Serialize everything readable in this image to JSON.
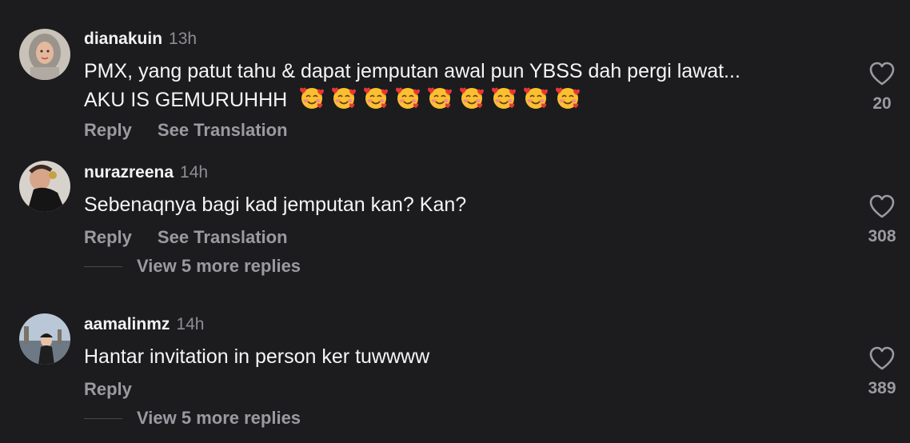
{
  "comments": [
    {
      "username": "dianakuin",
      "time": "13h",
      "text_line1": "PMX, yang patut tahu & dapat jemputan awal pun YBSS dah pergi lawat...",
      "text_line2": "AKU IS GEMURUHHH",
      "emoji_count": 9,
      "emoji_name": "smiling-face-with-hearts-emoji",
      "reply_label": "Reply",
      "translate_label": "See Translation",
      "likes": "20",
      "heart_icon": "heart-outline-icon"
    },
    {
      "username": "nurazreena",
      "time": "14h",
      "text_line1": "Sebenaqnya bagi kad jemputan kan? Kan?",
      "reply_label": "Reply",
      "translate_label": "See Translation",
      "likes": "308",
      "heart_icon": "heart-outline-icon",
      "view_replies": "View 5 more replies"
    },
    {
      "username": "aamalinmz",
      "time": "14h",
      "text_line1": "Hantar invitation in person ker tuwwww",
      "reply_label": "Reply",
      "likes": "389",
      "heart_icon": "heart-outline-icon",
      "view_replies": "View 5 more replies"
    }
  ],
  "colors": {
    "background": "#1c1c1e",
    "primary_text": "#f5f5f5",
    "secondary_text": "#9a9aa0",
    "timestamp": "#8e8e93"
  }
}
